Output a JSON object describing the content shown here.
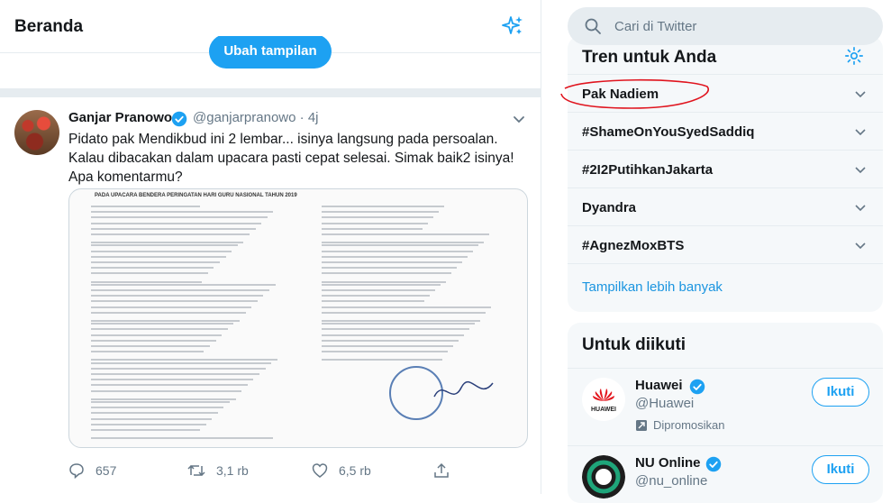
{
  "header": {
    "title": "Beranda"
  },
  "banner": {
    "button_label": "Ubah tampilan"
  },
  "tweet": {
    "name": "Ganjar Pranowo",
    "handle": "@ganjarpranowo",
    "separator": "·",
    "time": "4j",
    "text": "Pidato pak Mendikbud ini 2 lembar... isinya langsung pada persoalan. Kalau dibacakan dalam upacara pasti cepat selesai. Simak baik2 isinya! Apa komentarmu?",
    "document_header": "PADA UPACARA BENDERA PERINGATAN HARI GURU NASIONAL TAHUN 2019",
    "replies": "657",
    "retweets": "3,1 rb",
    "likes": "6,5 rb"
  },
  "search": {
    "placeholder": "Cari di Twitter"
  },
  "trends": {
    "title": "Tren untuk Anda",
    "items": [
      {
        "label": "Pak Nadiem"
      },
      {
        "label": "#ShameOnYouSyedSaddiq"
      },
      {
        "label": "#2I2PutihkanJakarta"
      },
      {
        "label": "Dyandra"
      },
      {
        "label": "#AgnezMoxBTS"
      }
    ],
    "show_more": "Tampilkan lebih banyak"
  },
  "follow": {
    "title": "Untuk diikuti",
    "accounts": [
      {
        "name": "Huawei",
        "handle": "@Huawei",
        "promoted": "Dipromosikan",
        "logo_text": "HUAWEI",
        "button": "Ikuti"
      },
      {
        "name": "NU Online",
        "handle": "@nu_online",
        "button": "Ikuti"
      }
    ]
  },
  "colors": {
    "accent": "#1da1f2",
    "annotation": "#e0141e"
  }
}
